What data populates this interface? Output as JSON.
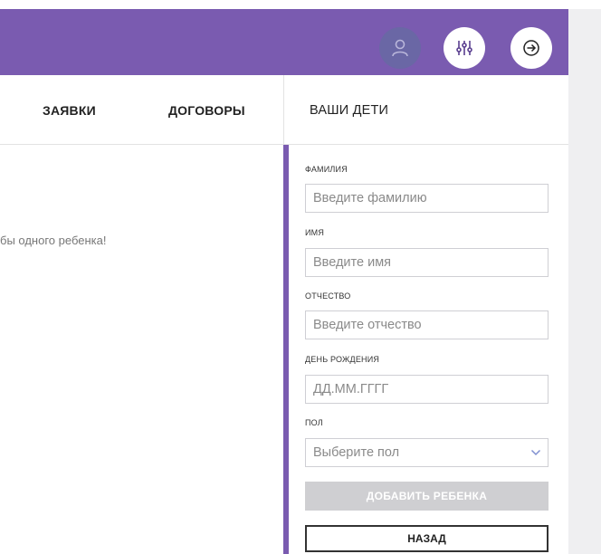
{
  "header": {
    "icons": [
      "user-icon",
      "sliders-icon",
      "logout-arrow-icon"
    ]
  },
  "tabs": [
    {
      "label": "ЗАЯВКИ"
    },
    {
      "label": "ДОГОВОРЫ"
    },
    {
      "label": "ВАШИ ДЕТИ"
    }
  ],
  "main": {
    "message": "бы одного ребенка!"
  },
  "form": {
    "surname": {
      "label": "ФАМИЛИЯ",
      "placeholder": "Введите фамилию"
    },
    "name": {
      "label": "ИМЯ",
      "placeholder": "Введите имя"
    },
    "patronymic": {
      "label": "ОТЧЕСТВО",
      "placeholder": "Введите отчество"
    },
    "birthday": {
      "label": "ДЕНЬ РОЖДЕНИЯ",
      "placeholder": "ДД.ММ.ГГГГ"
    },
    "gender": {
      "label": "ПОЛ",
      "value": "Выберите пол"
    },
    "add_button": "ДОБАВИТЬ РЕБЕНКА",
    "back_button": "НАЗАД"
  },
  "colors": {
    "brand": "#7a5bb0",
    "button_disabled": "#cfcfd2",
    "side_panel": "#efeff1"
  }
}
